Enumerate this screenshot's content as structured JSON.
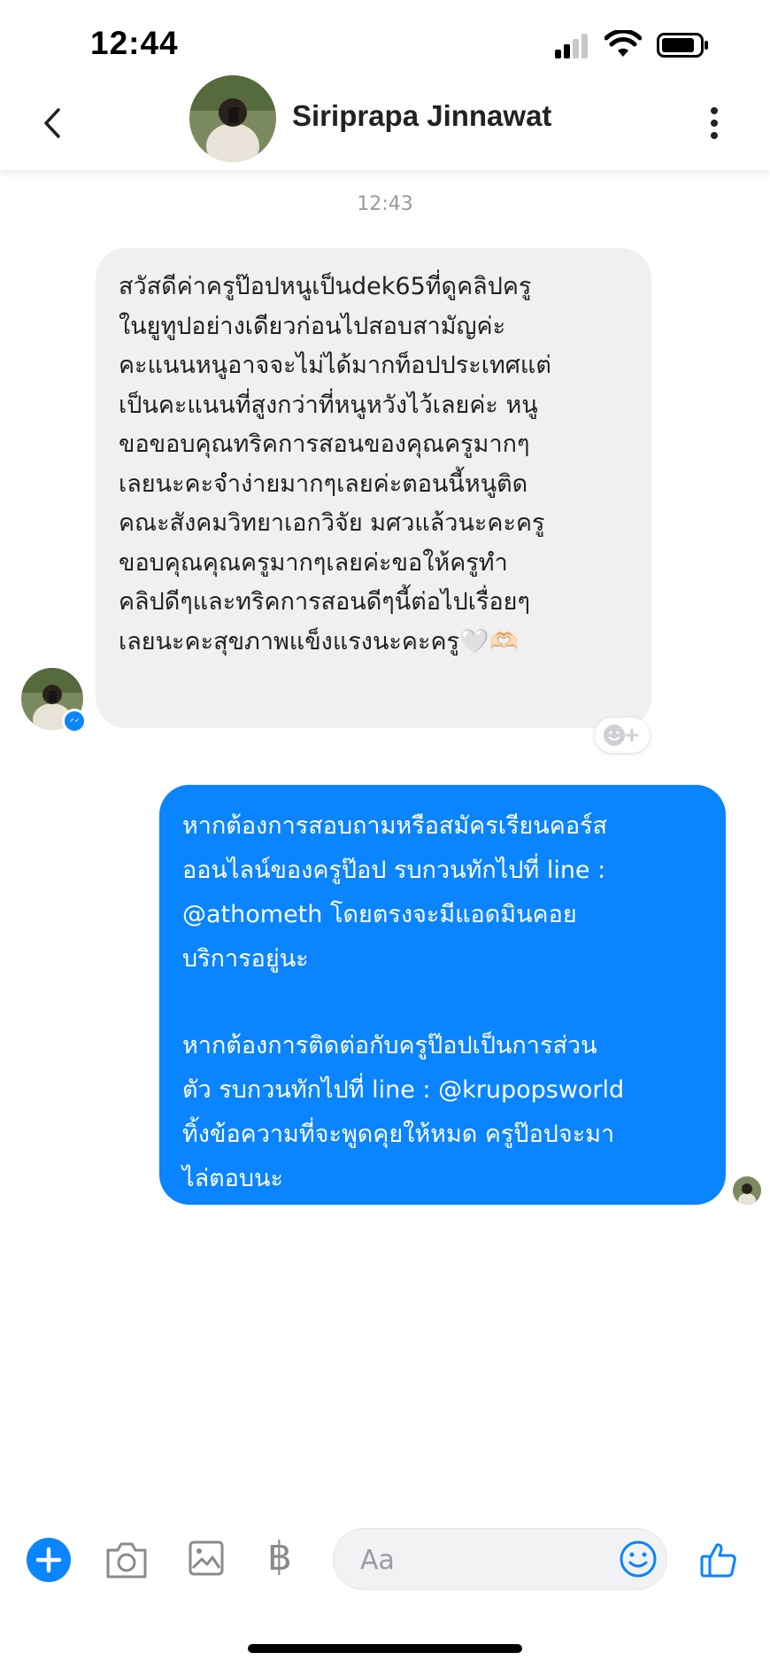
{
  "status_bar": {
    "time": "12:44"
  },
  "header": {
    "contact_name": "Siriprapa Jinnawat"
  },
  "conversation": {
    "timestamp": "12:43",
    "incoming_lines": [
      "สวัสดีค่าครูป๊อปหนูเป็นdek65ที่ดูคลิปครู",
      "ในยูทูปอย่างเดียวก่อนไปสอบสามัญค่ะ",
      "คะแนนหนูอาจจะไม่ได้มากท็อปประเทศแต่",
      "เป็นคะแนนที่สูงกว่าที่หนูหวังไว้เลยค่ะ หนู",
      "ขอขอบคุณทริคการสอนของคุณครูมากๆ",
      "เลยนะคะจำง่ายมากๆเลยค่ะตอนนี้หนูติด",
      "คณะสังคมวิทยาเอกวิจัย มศวแล้วนะคะครู",
      "ขอบคุณคุณครูมากๆเลยค่ะขอให้ครูทำ",
      "คลิปดีๆและทริคการสอนดีๆนี้ต่อไปเรื่อยๆ",
      "เลยนะคะสุขภาพแข็งแรงนะคะครู🤍🫶🏻"
    ],
    "outgoing_para1": [
      "หากต้องการสอบถามหรือสมัครเรียนคอร์ส",
      "ออนไลน์ของครูป๊อป รบกวนทักไปที่ line :",
      "@athometh โดยตรงจะมีแอดมินคอย",
      "บริการอยู่นะ"
    ],
    "outgoing_para2": [
      "หากต้องการติดต่อกับครูป๊อปเป็นการส่วน",
      "ตัว รบกวนทักไปที่ line : @krupopsworld",
      "ทิ้งข้อความที่จะพูดคุยให้หมด ครูป๊อปจะมา",
      "ไล่ตอบนะ"
    ]
  },
  "composer": {
    "placeholder": "Aa",
    "currency_symbol": "฿"
  },
  "colors": {
    "accent": "#0a84ff",
    "incoming_bubble": "#f0f0f0"
  }
}
